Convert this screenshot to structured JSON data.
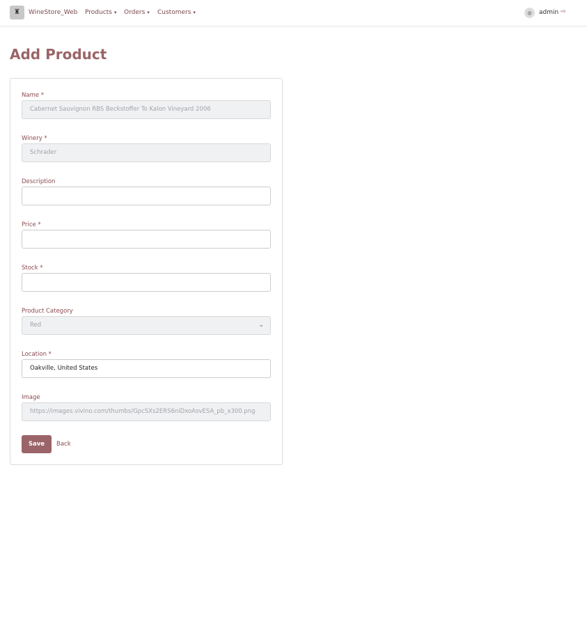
{
  "nav": {
    "brand": "WineStore_Web",
    "logo_icon": "wine-logo-icon",
    "menus": [
      {
        "label": "Products"
      },
      {
        "label": "Orders"
      },
      {
        "label": "Customers"
      }
    ],
    "chevron": "⌄",
    "user": "admin",
    "avatar_icon": "user-icon",
    "logout_icon": "logout-icon"
  },
  "page": {
    "title": "Add Product"
  },
  "form": {
    "fields": [
      {
        "label": "Name *",
        "value": "Cabernet Sauvignon RBS Beckstoffer To Kalon Vineyard 2006",
        "disabled": true
      },
      {
        "label": "Winery *",
        "value": "Schrader",
        "disabled": true
      },
      {
        "label": "Description",
        "value": ""
      },
      {
        "label": "Price *",
        "value": ""
      },
      {
        "label": "Stock *",
        "value": ""
      },
      {
        "label": "Product Category",
        "value": "Red",
        "disabled": true,
        "type": "select"
      },
      {
        "label": "Location *",
        "value": "Oakville, United States"
      },
      {
        "label": "Image",
        "value": "https://images.vivino.com/thumbs/GpcSXs2ERS6niDxoAsvESA_pb_x300.png",
        "disabled": true
      }
    ],
    "save": "Save",
    "back": "Back"
  },
  "colors": {
    "accent": "#9a6468",
    "label": "#8a4a50"
  }
}
